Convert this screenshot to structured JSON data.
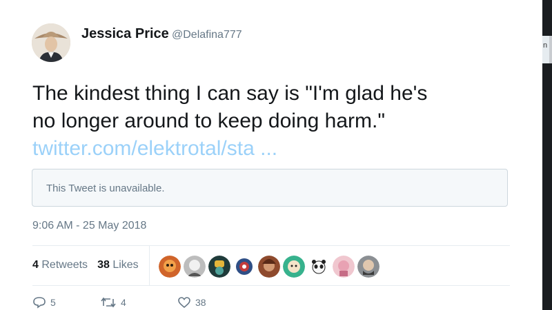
{
  "tweet": {
    "author_name": "Jessica Price",
    "author_handle": "@Delafina777",
    "text_line1": "The kindest thing I can say is \"I'm glad he's",
    "text_line2": "no longer around to keep doing harm.\"",
    "link_text": "twitter.com/elektrotal/sta ...",
    "quoted_unavailable": "This Tweet is unavailable.",
    "timestamp": "9:06 AM - 25 May 2018"
  },
  "stats": {
    "retweets_count": "4",
    "retweets_label": "Retweets",
    "likes_count": "38",
    "likes_label": "Likes"
  },
  "actions": {
    "reply_count": "5",
    "retweet_count": "4",
    "like_count": "38"
  },
  "side_panel": {
    "text": "n ic"
  },
  "colors": {
    "link": "#9bd1f9",
    "muted": "#657786",
    "text": "#14171a",
    "border": "#e6ecf0"
  },
  "icons": [
    "reply-icon",
    "retweet-icon",
    "heart-icon"
  ]
}
